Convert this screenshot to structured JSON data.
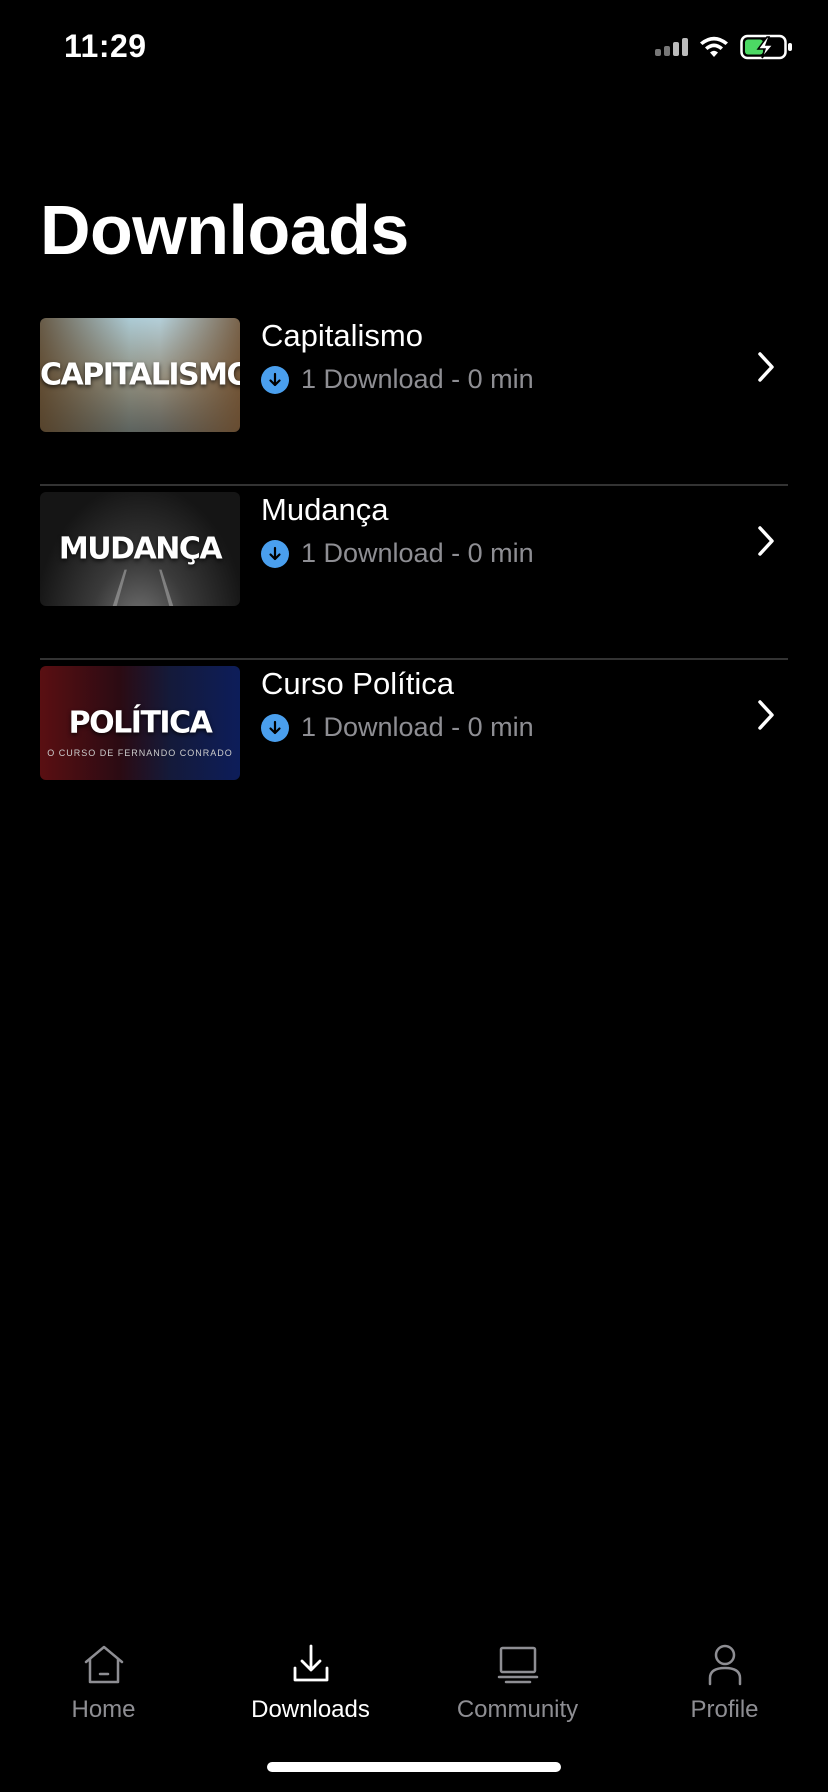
{
  "status_bar": {
    "time": "11:29"
  },
  "page": {
    "title": "Downloads"
  },
  "downloads": [
    {
      "title": "Capitalismo",
      "meta": "1 Download - 0 min",
      "thumb_text": "CAPITALISMO"
    },
    {
      "title": "Mudança",
      "meta": "1 Download - 0 min",
      "thumb_text": "MUDANÇA"
    },
    {
      "title": "Curso Política",
      "meta": "1 Download - 0 min",
      "thumb_text": "POLÍTICA",
      "thumb_sub": "O CURSO DE FERNANDO CONRADO"
    }
  ],
  "tab_bar": {
    "items": [
      {
        "label": "Home",
        "icon": "home-icon",
        "active": false
      },
      {
        "label": "Downloads",
        "icon": "download-icon",
        "active": true
      },
      {
        "label": "Community",
        "icon": "community-icon",
        "active": false
      },
      {
        "label": "Profile",
        "icon": "profile-icon",
        "active": false
      }
    ]
  },
  "colors": {
    "background": "#000000",
    "accent_download_badge": "#4a9fee",
    "secondary_text": "#8e8e93",
    "battery_charging": "#4cd964"
  }
}
